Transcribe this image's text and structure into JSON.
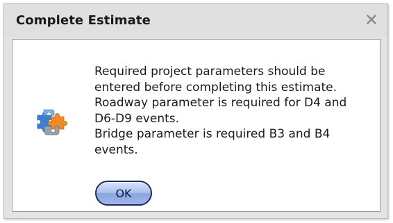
{
  "dialog": {
    "title": "Complete Estimate",
    "close_icon": "close-icon",
    "app_icon": "puzzle-pieces-icon",
    "message_lines": [
      "Required project parameters should be",
      "entered before completing this estimate.",
      "Roadway parameter is required for D4 and",
      "D6-D9 events.",
      "Bridge parameter is required B3 and B4",
      "events."
    ],
    "ok_label": "OK"
  },
  "colors": {
    "titlebar": "#e0e0e0",
    "content_background": "#ffffff",
    "ok_button_border": "#1e2b5a",
    "ok_button_fill": "#aac0ec",
    "close_icon": "#8a8a8a"
  }
}
